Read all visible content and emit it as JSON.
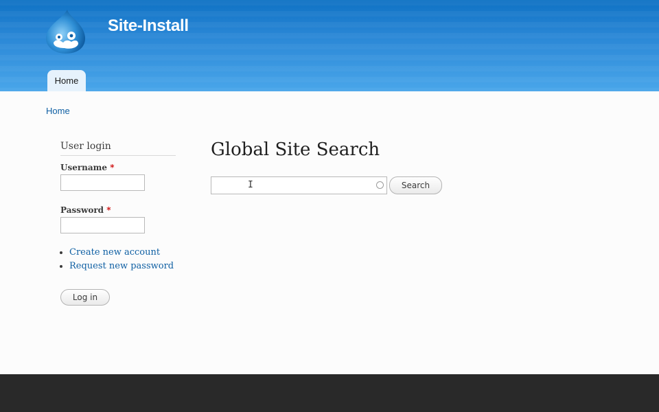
{
  "header": {
    "site_name": "Site-Install",
    "logo_icon": "drupal-drop-icon",
    "nav": [
      {
        "label": "Home",
        "active": true
      }
    ]
  },
  "breadcrumb": {
    "label": "Home"
  },
  "sidebar": {
    "title": "User login",
    "username_label": "Username",
    "password_label": "Password",
    "required_marker": "*",
    "username_value": "",
    "password_value": "",
    "links": [
      {
        "label": "Create new account"
      },
      {
        "label": "Request new password"
      }
    ],
    "login_button": "Log in"
  },
  "main": {
    "title": "Global Site Search",
    "search_value": "",
    "search_button": "Search"
  },
  "colors": {
    "header_top": "#0f72c4",
    "header_bottom": "#49a6ea",
    "link": "#0e5fa3",
    "required": "#cc0000",
    "footer": "#292929"
  }
}
